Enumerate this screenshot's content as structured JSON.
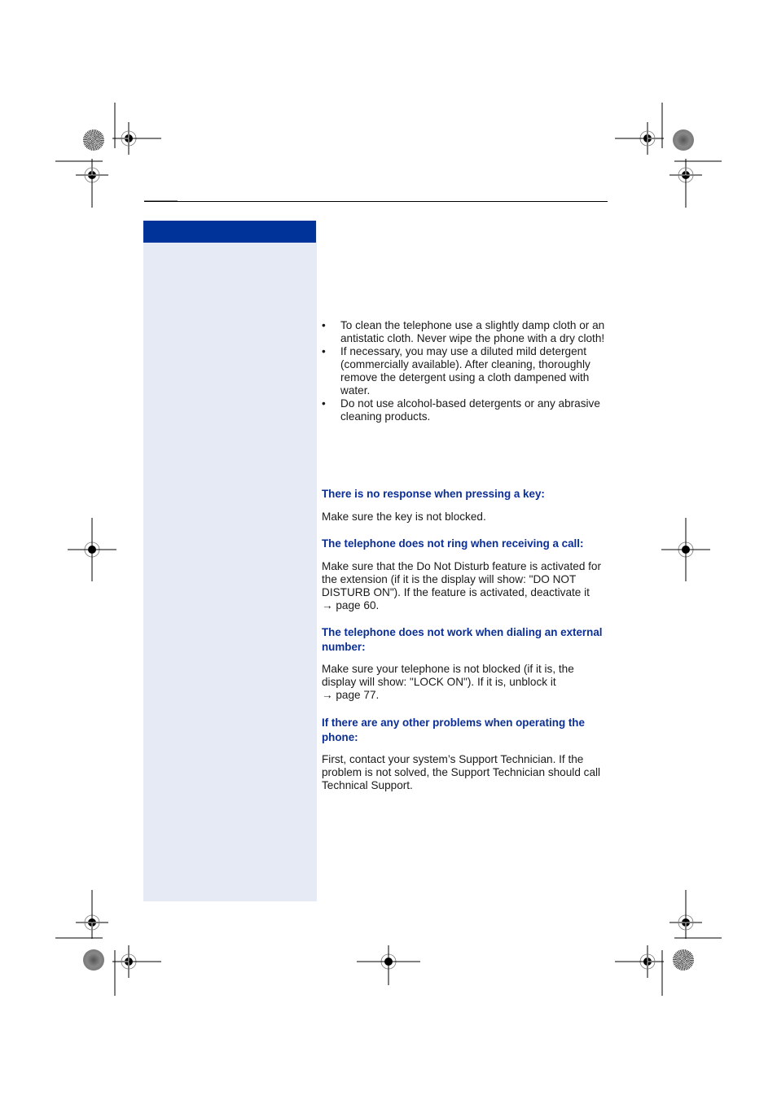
{
  "page": {
    "sidebar_header_color": "#003399",
    "sidebar_color": "#e6eaf5",
    "heading_color": "#0b2f96"
  },
  "cleaning": {
    "bullets": [
      {
        "text": "To clean the telephone use a slightly damp cloth or an antistatic cloth. Never wipe the phone with a dry cloth!"
      },
      {
        "text": "If necessary, you may use a diluted mild detergent (commercially available). After cleaning, thoroughly remove the detergent using a cloth dampened with water."
      },
      {
        "text": "Do not use alcohol-based detergents or any abrasive cleaning products."
      }
    ],
    "bullet_glyph": "•"
  },
  "troubleshooting": [
    {
      "heading": "There is no response when pressing a key:",
      "body": "Make sure the key is not blocked."
    },
    {
      "heading": "The telephone does not ring when receiving a call:",
      "body": "Make sure that the Do Not Disturb feature is activated for the extension (if it is the display will show: \"DO NOT DISTURB ON\"). If the feature is activated, deactivate it",
      "ref_arrow": "→",
      "ref": "page 60."
    },
    {
      "heading": "The telephone does not work when dialing an external number:",
      "body": "Make sure your telephone is not blocked (if it is, the display will show: \"LOCK ON\"). If it is, unblock it",
      "ref_arrow": "→",
      "ref": "page 77."
    },
    {
      "heading": "If there are any other problems when operating the phone:",
      "body": "First, contact your system’s Support Technician. If the problem is not solved, the Support Technician should call Technical Support."
    }
  ]
}
